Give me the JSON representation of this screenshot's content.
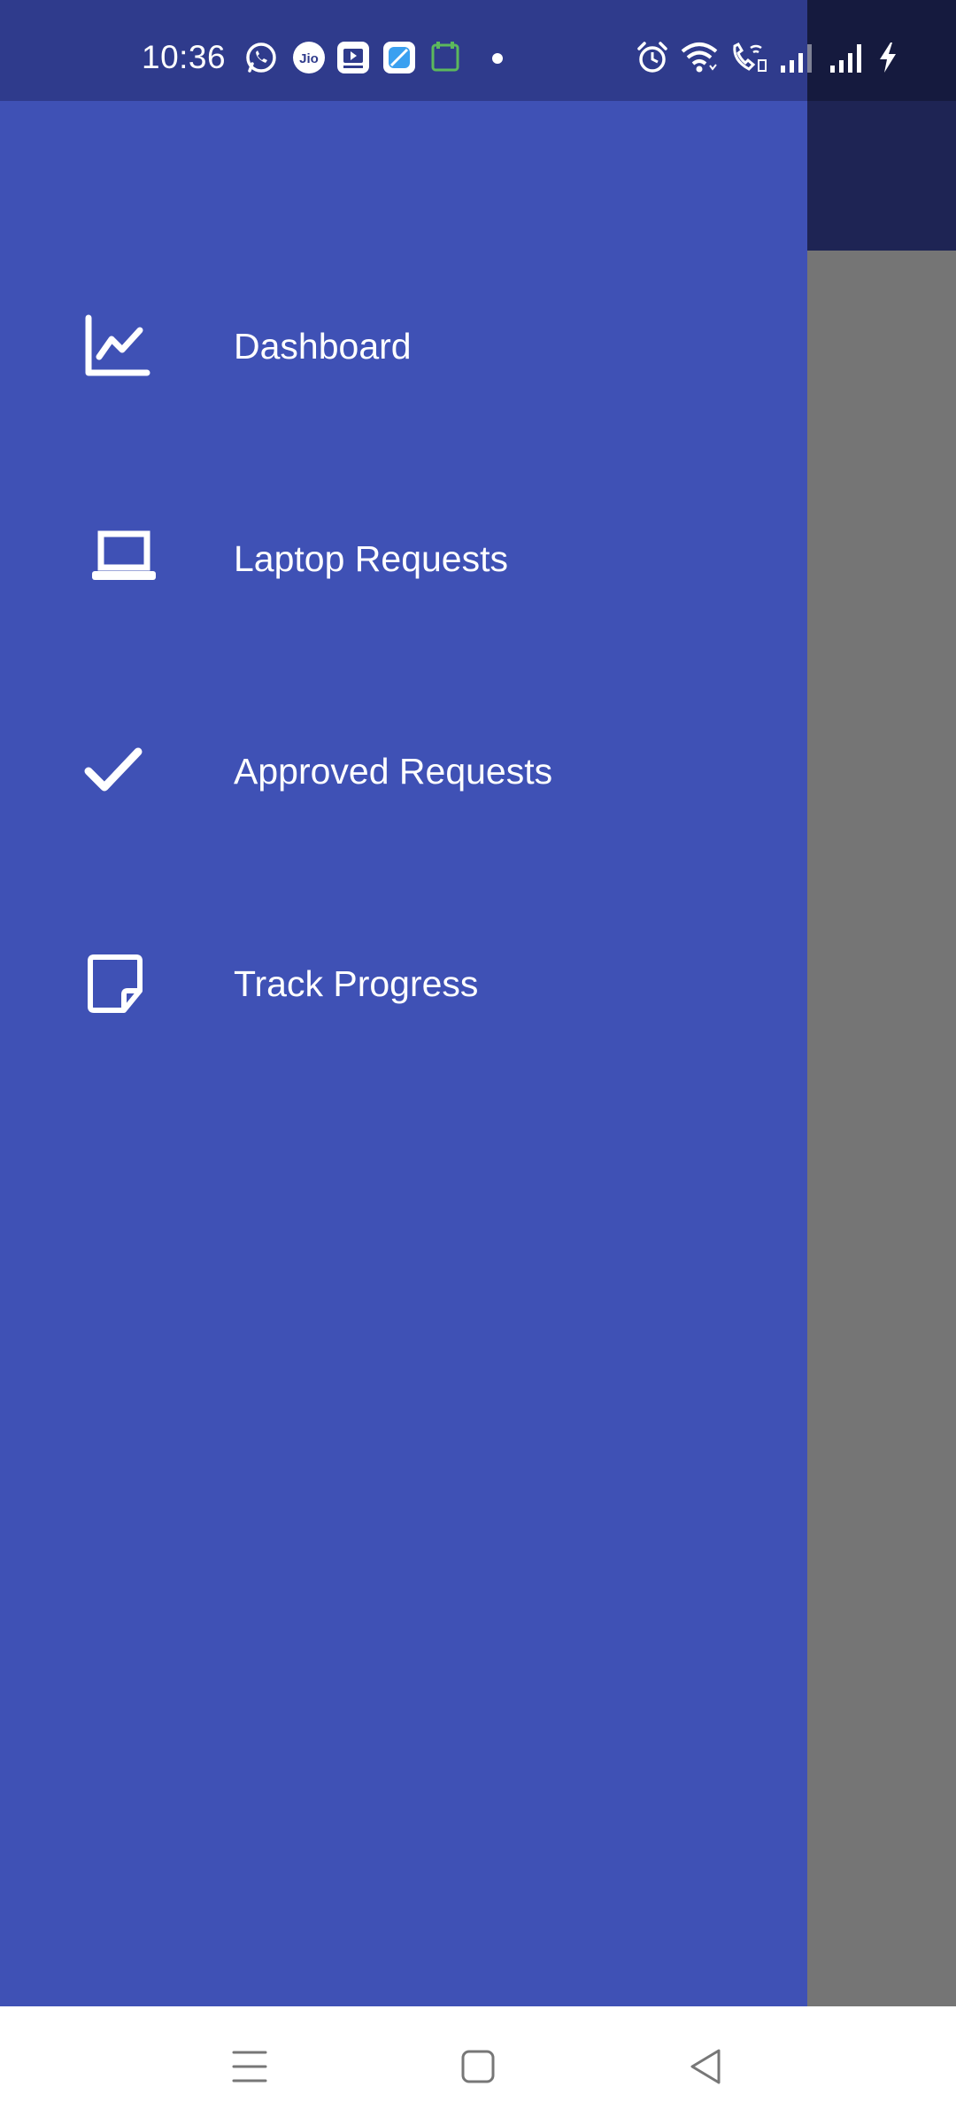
{
  "status_bar": {
    "time": "10:36",
    "left_icons": [
      "whatsapp-icon",
      "jio-icon",
      "youtube-icon",
      "app-icon",
      "notes-icon",
      "dot-icon"
    ],
    "right_icons": [
      "alarm-icon",
      "wifi-icon",
      "wifi-call-icon",
      "signal-icon",
      "signal-icon",
      "charging-icon"
    ],
    "jio_text": "Jio"
  },
  "drawer": {
    "background_color": "#3f51b5",
    "items": [
      {
        "label": "Dashboard",
        "icon": "line-chart-icon"
      },
      {
        "label": "Laptop Requests",
        "icon": "laptop-icon"
      },
      {
        "label": "Approved Requests",
        "icon": "check-icon"
      },
      {
        "label": "Track Progress",
        "icon": "note-icon"
      }
    ]
  },
  "nav_bar": {
    "buttons": [
      "menu-icon",
      "home-icon",
      "back-icon"
    ]
  }
}
